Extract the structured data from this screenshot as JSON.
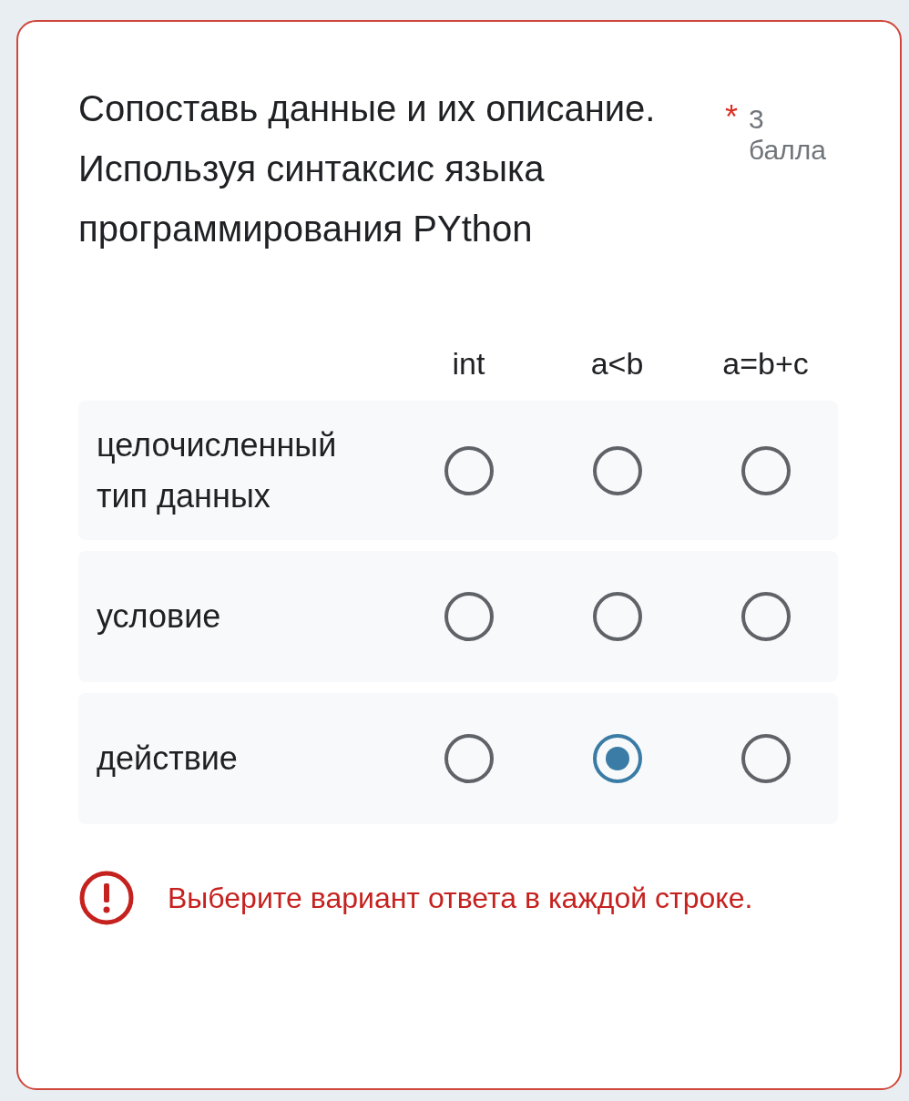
{
  "question": {
    "title": "Сопоставь данные и их описание. Используя синтаксис языка программирования PYthon",
    "required_mark": "*",
    "points": "3 балла"
  },
  "columns": [
    "int",
    "a<b",
    "a=b+c"
  ],
  "rows": [
    {
      "label": "целочисленный тип данных",
      "cells": [
        {
          "selected": false
        },
        {
          "selected": false
        },
        {
          "selected": false
        }
      ]
    },
    {
      "label": "условие",
      "cells": [
        {
          "selected": false
        },
        {
          "selected": false
        },
        {
          "selected": false
        }
      ]
    },
    {
      "label": "действие",
      "cells": [
        {
          "selected": false
        },
        {
          "selected": true
        },
        {
          "selected": false
        }
      ]
    }
  ],
  "error": {
    "text": "Выберите вариант ответа в каждой строке."
  }
}
